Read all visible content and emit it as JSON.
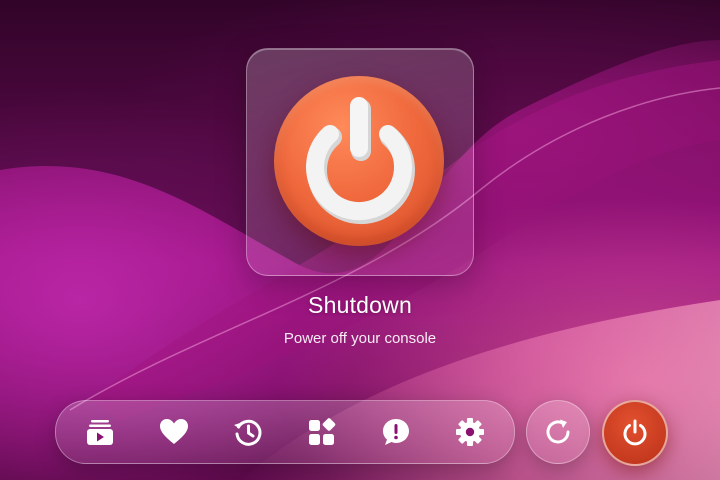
{
  "selected": {
    "title": "Shutdown",
    "subtitle": "Power off your console"
  },
  "dock_items": [
    {
      "name": "media-library-icon"
    },
    {
      "name": "heart-icon"
    },
    {
      "name": "history-icon"
    },
    {
      "name": "apps-icon"
    },
    {
      "name": "feedback-icon"
    },
    {
      "name": "gear-icon"
    }
  ],
  "side_buttons": [
    {
      "name": "restart-icon"
    },
    {
      "name": "power-icon",
      "active": true
    }
  ],
  "colors": {
    "accent_orange": "#f06a3e",
    "shutdown_red": "#c63a1f",
    "icon_white": "#ffffff"
  }
}
